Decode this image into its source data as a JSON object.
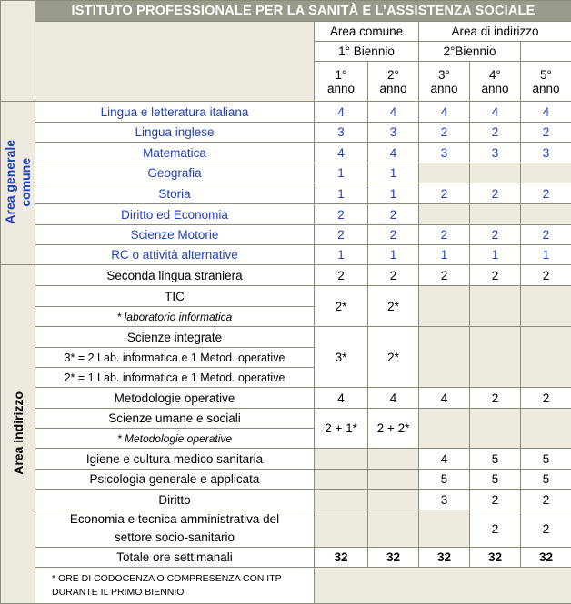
{
  "title": "ISTITUTO PROFESSIONALE PER LA SANITÀ E L’ASSISTENZA SOCIALE",
  "header": {
    "area_comune": "Area comune",
    "area_indirizzo": "Area di indirizzo",
    "primo_biennio": "1° Biennio",
    "secondo_biennio": "2°Biennio",
    "anni": [
      "1°",
      "2°",
      "3°",
      "4°",
      "5°"
    ],
    "anno_word": "anno"
  },
  "sections": {
    "generale_line1": "Area generale",
    "generale_line2": "comune",
    "indirizzo": "Area indirizzo"
  },
  "general_rows": [
    {
      "subject": "Lingua e letteratura italiana",
      "hours": [
        "4",
        "4",
        "4",
        "4",
        "4"
      ]
    },
    {
      "subject": "Lingua inglese",
      "hours": [
        "3",
        "3",
        "2",
        "2",
        "2"
      ]
    },
    {
      "subject": "Matematica",
      "hours": [
        "4",
        "4",
        "3",
        "3",
        "3"
      ]
    },
    {
      "subject": "Geografia",
      "hours": [
        "1",
        "1",
        "",
        "",
        ""
      ]
    },
    {
      "subject": "Storia",
      "hours": [
        "1",
        "1",
        "2",
        "2",
        "2"
      ]
    },
    {
      "subject": "Diritto ed Economia",
      "hours": [
        "2",
        "2",
        "",
        "",
        ""
      ]
    },
    {
      "subject": "Scienze Motorie",
      "hours": [
        "2",
        "2",
        "2",
        "2",
        "2"
      ]
    },
    {
      "subject": "RC o attività alternative",
      "hours": [
        "1",
        "1",
        "1",
        "1",
        "1"
      ]
    }
  ],
  "indirizzo": {
    "seconda_lingua": {
      "subject": "Seconda lingua straniera",
      "hours": [
        "2",
        "2",
        "2",
        "2",
        "2"
      ]
    },
    "tic": {
      "subject": "TIC",
      "note": "* laboratorio informatica",
      "hours": [
        "2*",
        "2*"
      ]
    },
    "scienze_integrate": {
      "subject": "Scienze integrate",
      "note1": "3* = 2 Lab. informatica e 1 Metod. operative",
      "note2": "2* = 1 Lab. informatica e 1 Metod. operative",
      "hours": [
        "3*",
        "2*"
      ]
    },
    "metodologie": {
      "subject": "Metodologie  operative",
      "hours": [
        "4",
        "4",
        "4",
        "2",
        "2"
      ]
    },
    "scienze_umane": {
      "subject": "Scienze umane e sociali",
      "note": "* Metodologie operative",
      "hours": [
        "2 + 1*",
        "2 + 2*"
      ]
    },
    "igiene": {
      "subject": "Igiene e cultura medico sanitaria",
      "hours": [
        "4",
        "5",
        "5"
      ]
    },
    "psicologia": {
      "subject": "Psicologia generale e applicata",
      "hours": [
        "5",
        "5",
        "5"
      ]
    },
    "diritto": {
      "subject": "Diritto",
      "hours": [
        "3",
        "2",
        "2"
      ]
    },
    "economia": {
      "line1": "Economia e tecnica amministrativa del",
      "line2": "settore socio-sanitario",
      "hours": [
        "2",
        "2"
      ]
    }
  },
  "totale": {
    "label": "Totale ore settimanali",
    "hours": [
      "32",
      "32",
      "32",
      "32",
      "32"
    ]
  },
  "footnote": {
    "line1": "* ORE DI CODOCENZA O COMPRESENZA CON ITP",
    "line2": "DURANTE IL PRIMO BIENNIO"
  }
}
